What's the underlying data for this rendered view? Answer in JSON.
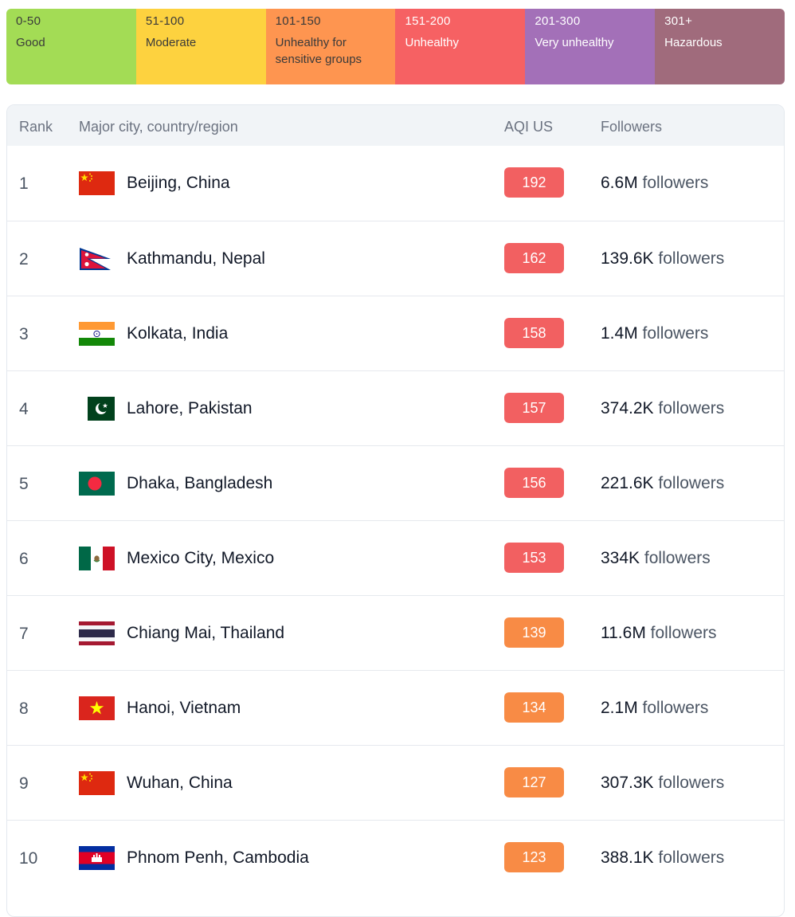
{
  "legend": [
    {
      "range": "0-50",
      "label": "Good",
      "color": "#a3dc55",
      "dark": false
    },
    {
      "range": "51-100",
      "label": "Moderate",
      "color": "#fdd23f",
      "dark": false
    },
    {
      "range": "101-150",
      "label": "Unhealthy for sensitive groups",
      "color": "#fe9550",
      "dark": false
    },
    {
      "range": "151-200",
      "label": "Unhealthy",
      "color": "#f66163",
      "dark": true
    },
    {
      "range": "201-300",
      "label": "Very unhealthy",
      "color": "#a370b8",
      "dark": true
    },
    {
      "range": "301+",
      "label": "Hazardous",
      "color": "#a06b7c",
      "dark": true
    }
  ],
  "table": {
    "headers": {
      "rank": "Rank",
      "city": "Major city, country/region",
      "aqi": "AQI US",
      "followers": "Followers"
    },
    "followers_suffix": "followers",
    "rows": [
      {
        "rank": "1",
        "city": "Beijing, China",
        "flag": "china-flag-icon",
        "aqi": "192",
        "aqi_color": "#f26061",
        "followers": "6.6M"
      },
      {
        "rank": "2",
        "city": "Kathmandu, Nepal",
        "flag": "nepal-flag-icon",
        "aqi": "162",
        "aqi_color": "#f26061",
        "followers": "139.6K"
      },
      {
        "rank": "3",
        "city": "Kolkata, India",
        "flag": "india-flag-icon",
        "aqi": "158",
        "aqi_color": "#f26061",
        "followers": "1.4M"
      },
      {
        "rank": "4",
        "city": "Lahore, Pakistan",
        "flag": "pakistan-flag-icon",
        "aqi": "157",
        "aqi_color": "#f26061",
        "followers": "374.2K"
      },
      {
        "rank": "5",
        "city": "Dhaka, Bangladesh",
        "flag": "bangladesh-flag-icon",
        "aqi": "156",
        "aqi_color": "#f26061",
        "followers": "221.6K"
      },
      {
        "rank": "6",
        "city": "Mexico City, Mexico",
        "flag": "mexico-flag-icon",
        "aqi": "153",
        "aqi_color": "#f26061",
        "followers": "334K"
      },
      {
        "rank": "7",
        "city": "Chiang Mai, Thailand",
        "flag": "thailand-flag-icon",
        "aqi": "139",
        "aqi_color": "#f88b45",
        "followers": "11.6M"
      },
      {
        "rank": "8",
        "city": "Hanoi, Vietnam",
        "flag": "vietnam-flag-icon",
        "aqi": "134",
        "aqi_color": "#f88b45",
        "followers": "2.1M"
      },
      {
        "rank": "9",
        "city": "Wuhan, China",
        "flag": "china-flag-icon",
        "aqi": "127",
        "aqi_color": "#f88b45",
        "followers": "307.3K"
      },
      {
        "rank": "10",
        "city": "Phnom Penh, Cambodia",
        "flag": "cambodia-flag-icon",
        "aqi": "123",
        "aqi_color": "#f88b45",
        "followers": "388.1K"
      }
    ]
  }
}
